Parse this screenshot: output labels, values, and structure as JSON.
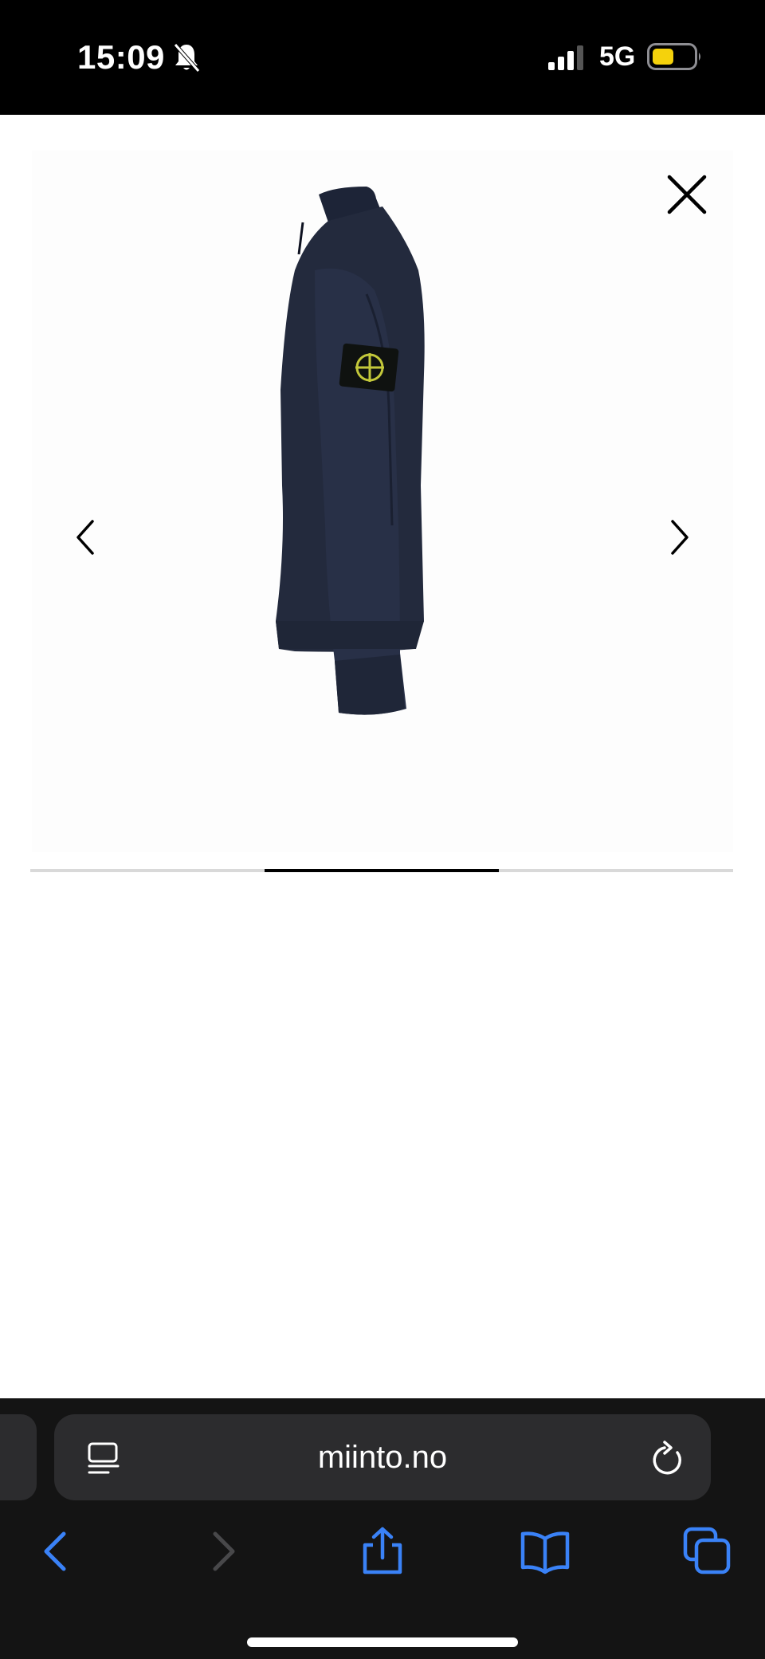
{
  "status_bar": {
    "time": "15:09",
    "network": "5G",
    "icons": [
      "bell-slash-icon",
      "signal-bars-icon",
      "battery-icon"
    ],
    "battery_color": "#f5d20c"
  },
  "gallery": {
    "image_description_icon": "navy-sweatshirt-side-view",
    "close_icon": "close-icon",
    "prev_icon": "chevron-left-icon",
    "next_icon": "chevron-right-icon",
    "current_slide": 2,
    "total_slides": 3
  },
  "browser": {
    "url": "miinto.no",
    "accent_color": "#3a82f7",
    "toolbar": [
      "back-icon",
      "forward-icon",
      "share-icon",
      "bookmarks-icon",
      "tabs-icon"
    ]
  }
}
